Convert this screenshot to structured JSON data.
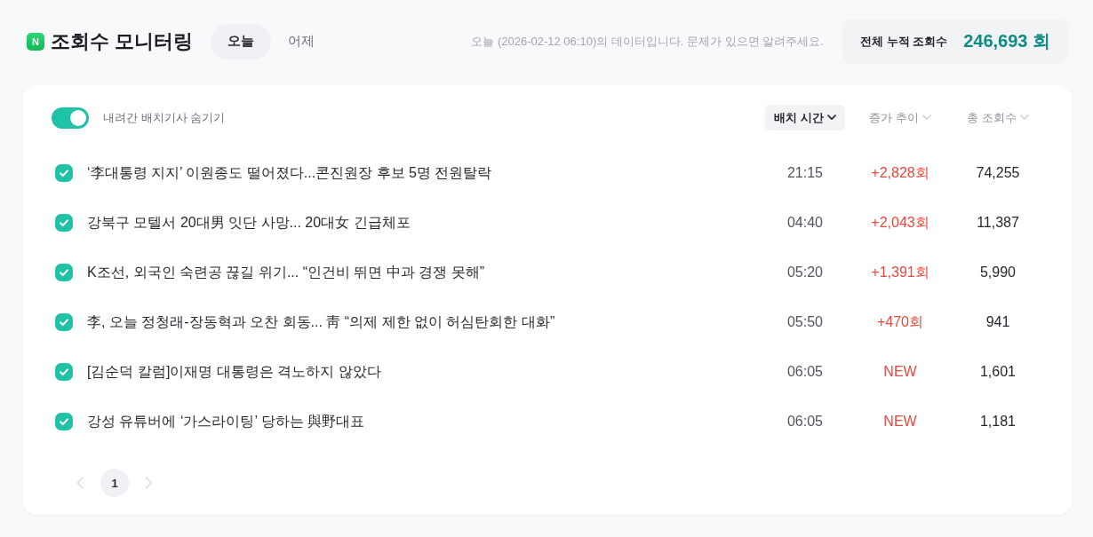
{
  "header": {
    "logo": "N",
    "title": "조회수 모니터링",
    "tabs": [
      {
        "label": "오늘",
        "selected": true
      },
      {
        "label": "어제",
        "selected": false
      }
    ],
    "notice": "오늘 (2026-02-12 06:10)의 데이터입니다. 문제가 있으면 알려주세요.",
    "total": {
      "label": "전체 누적 조회수",
      "value": "246,693 회"
    }
  },
  "filter": {
    "label": "내려간 배치기사 숨기기",
    "on": true
  },
  "sort_columns": [
    {
      "label": "배치 시간",
      "selected": true
    },
    {
      "label": "증가 추이",
      "selected": false
    },
    {
      "label": "총 조회수",
      "selected": false
    }
  ],
  "articles": [
    {
      "checked": true,
      "title": "‘李대통령 지지’ 이원종도 떨어졌다...콘진원장 후보 5명 전원탈락",
      "time": "21:15",
      "increase": "+2,828회",
      "total": "74,255"
    },
    {
      "checked": true,
      "title": "강북구 모텔서 20대男 잇단 사망... 20대女 긴급체포",
      "time": "04:40",
      "increase": "+2,043회",
      "total": "11,387"
    },
    {
      "checked": true,
      "title": "K조선, 외국인 숙련공 끊길 위기... “인건비 뛰면 中과 경쟁 못해”",
      "time": "05:20",
      "increase": "+1,391회",
      "total": "5,990"
    },
    {
      "checked": true,
      "title": "李, 오늘 정청래-장동혁과 오찬 회동... 靑 “의제 제한 없이 허심탄회한 대화”",
      "time": "05:50",
      "increase": "+470회",
      "total": "941"
    },
    {
      "checked": true,
      "title": "[김순덕 칼럼]이재명 대통령은 격노하지 않았다",
      "time": "06:05",
      "increase": "NEW",
      "total": "1,601"
    },
    {
      "checked": true,
      "title": "강성 유튜버에 ‘가스라이팅’ 당하는 與野대표",
      "time": "06:05",
      "increase": "NEW",
      "total": "1,181"
    }
  ],
  "pagination": {
    "prev_disabled": true,
    "pages": [
      {
        "label": "1",
        "selected": true
      }
    ],
    "next_disabled": true
  }
}
